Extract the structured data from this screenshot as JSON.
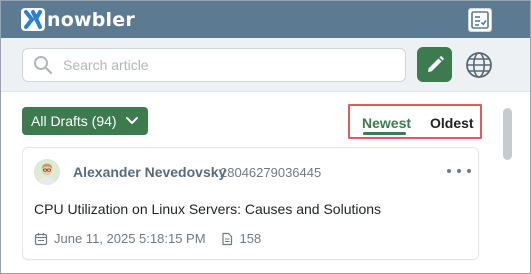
{
  "header": {
    "app_name": "nowbler",
    "logo_icon": "nowbler-logo-icon",
    "menu_icon": "checklist-icon"
  },
  "search": {
    "placeholder": "Search article",
    "value": "",
    "icon": "search-icon"
  },
  "toolbar": {
    "edit_icon": "pencil-icon",
    "language_icon": "globe-icon"
  },
  "filter": {
    "drafts_label": "All Drafts (94)",
    "chevron_icon": "chevron-down-icon"
  },
  "sort": {
    "tabs": [
      {
        "label": "Newest",
        "active": true
      },
      {
        "label": "Oldest",
        "active": false
      }
    ]
  },
  "articles": [
    {
      "author": "Alexander Nevedovsky",
      "author_id": "28046279036445",
      "title": "CPU Utilization on Linux Servers: Causes and Solutions",
      "date": "June 11, 2025 5:18:15 PM",
      "count": "158"
    }
  ],
  "colors": {
    "header_bg": "#5d7a93",
    "accent_green": "#3d7a4f",
    "highlight_red": "#e05a66"
  }
}
